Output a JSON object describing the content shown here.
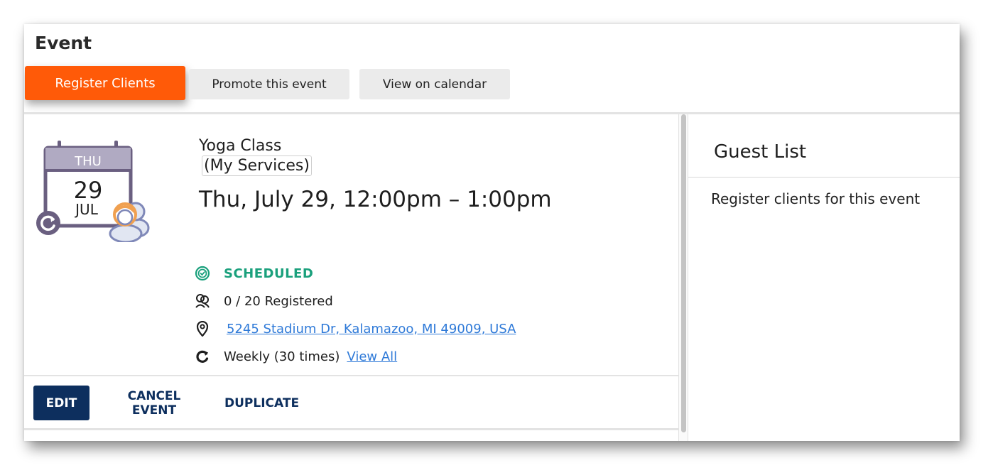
{
  "header": {
    "title": "Event",
    "register_label": "Register Clients",
    "promote_label": "Promote this event",
    "calendar_label": "View on calendar"
  },
  "calendar_icon": {
    "weekday": "THU",
    "day": "29",
    "month": "JUL"
  },
  "event": {
    "name": "Yoga Class",
    "service": "(My Services)",
    "datetime": "Thu, July 29, 12:00pm – 1:00pm",
    "status": "SCHEDULED",
    "registered": "0 / 20 Registered",
    "address": "5245 Stadium Dr, Kalamazoo, MI 49009, USA",
    "recurrence": "Weekly (30 times)",
    "view_all": "View All"
  },
  "actions": {
    "edit": "EDIT",
    "cancel": "CANCEL EVENT",
    "duplicate": "DUPLICATE"
  },
  "guest_list": {
    "title": "Guest List",
    "empty_text": "Register clients for this event"
  },
  "colors": {
    "primary": "#ff5a08",
    "navy": "#0d2f5e",
    "status": "#1aa07c",
    "link": "#2f7ad8",
    "calendar_icon": "#6a5f80"
  },
  "icons": [
    "calendar-icon",
    "refresh-icon",
    "people-icon",
    "check-circle-icon",
    "registered-people-icon",
    "location-pin-icon",
    "repeat-icon"
  ]
}
